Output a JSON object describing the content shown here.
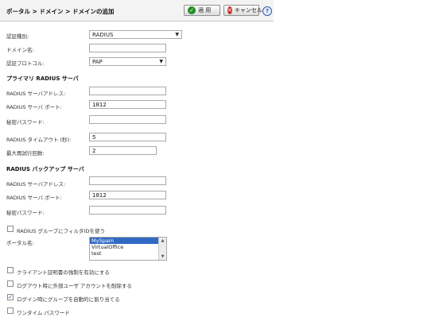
{
  "header": {
    "breadcrumb": "ポータル > ドメイン > ドメインの追加",
    "apply_label": "適 用",
    "apply_icon": "check-icon",
    "cancel_label": "キャンセル",
    "cancel_icon": "close-icon",
    "help_icon": "help-icon"
  },
  "form": {
    "auth_type": {
      "label": "認証種別:",
      "value": "RADIUS"
    },
    "domain_name": {
      "label": "ドメイン名:",
      "value": ""
    },
    "auth_protocol": {
      "label": "認証プロトコル:",
      "value": "PAP"
    },
    "primary": {
      "title": "プライマリ RADIUS サーバ",
      "address_label": "RADIUS サーバアドレス:",
      "address_value": "",
      "port_label": "RADIUS サーバ ポート:",
      "port_value": "1812",
      "secret_label": "秘密パスワード:",
      "secret_value": ""
    },
    "timeout": {
      "label": "RADIUS タイムアウト (秒):",
      "value": "5"
    },
    "retries": {
      "label": "最大再試行回数:",
      "value": "2"
    },
    "backup": {
      "title": "RADIUS バックアップ サーバ",
      "address_label": "RADIUS サーバアドレス:",
      "address_value": "",
      "port_label": "RADIUS サーバ ポート:",
      "port_value": "1812",
      "secret_label": "秘密パスワード:",
      "secret_value": ""
    },
    "filter_id": {
      "label": "RADIUS グループにフィルタIDを使う",
      "checked": false
    },
    "portal": {
      "label": "ポータル名:",
      "options": [
        "MySpam",
        "VirtualOffice",
        "test"
      ],
      "selected": "MySpam"
    },
    "client_cert": {
      "label": "クライアント証明書の強制を有効にする",
      "checked": false
    },
    "logout_delete": {
      "label": "ログアウト時に外部ユーザ アカウントを削除する",
      "checked": false
    },
    "login_group": {
      "label": "ログイン時にグループを自動的に割り当てる",
      "checked": true
    },
    "otp": {
      "label": "ワンタイム パスワード",
      "checked": false
    }
  }
}
